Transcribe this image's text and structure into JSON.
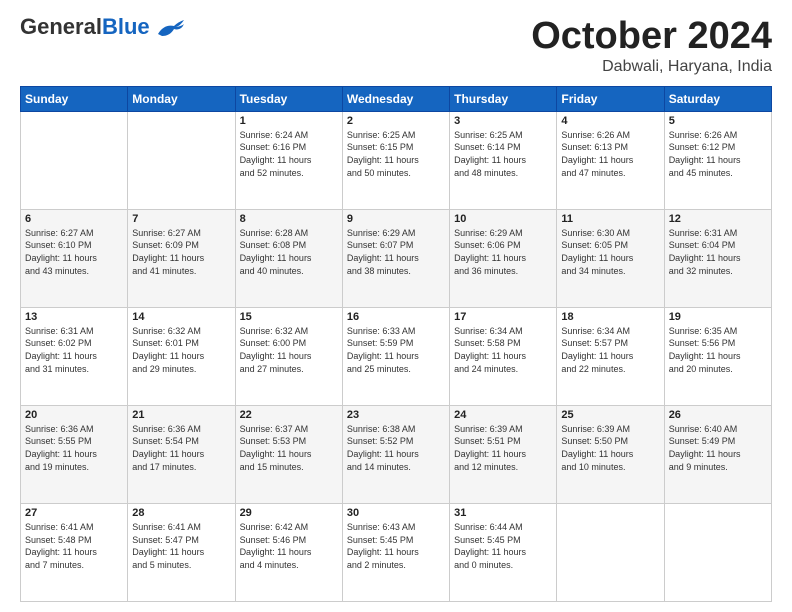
{
  "header": {
    "logo_general": "General",
    "logo_blue": "Blue",
    "month_title": "October 2024",
    "subtitle": "Dabwali, Haryana, India"
  },
  "days_of_week": [
    "Sunday",
    "Monday",
    "Tuesday",
    "Wednesday",
    "Thursday",
    "Friday",
    "Saturday"
  ],
  "weeks": [
    [
      {
        "day": "",
        "info": ""
      },
      {
        "day": "",
        "info": ""
      },
      {
        "day": "1",
        "info": "Sunrise: 6:24 AM\nSunset: 6:16 PM\nDaylight: 11 hours\nand 52 minutes."
      },
      {
        "day": "2",
        "info": "Sunrise: 6:25 AM\nSunset: 6:15 PM\nDaylight: 11 hours\nand 50 minutes."
      },
      {
        "day": "3",
        "info": "Sunrise: 6:25 AM\nSunset: 6:14 PM\nDaylight: 11 hours\nand 48 minutes."
      },
      {
        "day": "4",
        "info": "Sunrise: 6:26 AM\nSunset: 6:13 PM\nDaylight: 11 hours\nand 47 minutes."
      },
      {
        "day": "5",
        "info": "Sunrise: 6:26 AM\nSunset: 6:12 PM\nDaylight: 11 hours\nand 45 minutes."
      }
    ],
    [
      {
        "day": "6",
        "info": "Sunrise: 6:27 AM\nSunset: 6:10 PM\nDaylight: 11 hours\nand 43 minutes."
      },
      {
        "day": "7",
        "info": "Sunrise: 6:27 AM\nSunset: 6:09 PM\nDaylight: 11 hours\nand 41 minutes."
      },
      {
        "day": "8",
        "info": "Sunrise: 6:28 AM\nSunset: 6:08 PM\nDaylight: 11 hours\nand 40 minutes."
      },
      {
        "day": "9",
        "info": "Sunrise: 6:29 AM\nSunset: 6:07 PM\nDaylight: 11 hours\nand 38 minutes."
      },
      {
        "day": "10",
        "info": "Sunrise: 6:29 AM\nSunset: 6:06 PM\nDaylight: 11 hours\nand 36 minutes."
      },
      {
        "day": "11",
        "info": "Sunrise: 6:30 AM\nSunset: 6:05 PM\nDaylight: 11 hours\nand 34 minutes."
      },
      {
        "day": "12",
        "info": "Sunrise: 6:31 AM\nSunset: 6:04 PM\nDaylight: 11 hours\nand 32 minutes."
      }
    ],
    [
      {
        "day": "13",
        "info": "Sunrise: 6:31 AM\nSunset: 6:02 PM\nDaylight: 11 hours\nand 31 minutes."
      },
      {
        "day": "14",
        "info": "Sunrise: 6:32 AM\nSunset: 6:01 PM\nDaylight: 11 hours\nand 29 minutes."
      },
      {
        "day": "15",
        "info": "Sunrise: 6:32 AM\nSunset: 6:00 PM\nDaylight: 11 hours\nand 27 minutes."
      },
      {
        "day": "16",
        "info": "Sunrise: 6:33 AM\nSunset: 5:59 PM\nDaylight: 11 hours\nand 25 minutes."
      },
      {
        "day": "17",
        "info": "Sunrise: 6:34 AM\nSunset: 5:58 PM\nDaylight: 11 hours\nand 24 minutes."
      },
      {
        "day": "18",
        "info": "Sunrise: 6:34 AM\nSunset: 5:57 PM\nDaylight: 11 hours\nand 22 minutes."
      },
      {
        "day": "19",
        "info": "Sunrise: 6:35 AM\nSunset: 5:56 PM\nDaylight: 11 hours\nand 20 minutes."
      }
    ],
    [
      {
        "day": "20",
        "info": "Sunrise: 6:36 AM\nSunset: 5:55 PM\nDaylight: 11 hours\nand 19 minutes."
      },
      {
        "day": "21",
        "info": "Sunrise: 6:36 AM\nSunset: 5:54 PM\nDaylight: 11 hours\nand 17 minutes."
      },
      {
        "day": "22",
        "info": "Sunrise: 6:37 AM\nSunset: 5:53 PM\nDaylight: 11 hours\nand 15 minutes."
      },
      {
        "day": "23",
        "info": "Sunrise: 6:38 AM\nSunset: 5:52 PM\nDaylight: 11 hours\nand 14 minutes."
      },
      {
        "day": "24",
        "info": "Sunrise: 6:39 AM\nSunset: 5:51 PM\nDaylight: 11 hours\nand 12 minutes."
      },
      {
        "day": "25",
        "info": "Sunrise: 6:39 AM\nSunset: 5:50 PM\nDaylight: 11 hours\nand 10 minutes."
      },
      {
        "day": "26",
        "info": "Sunrise: 6:40 AM\nSunset: 5:49 PM\nDaylight: 11 hours\nand 9 minutes."
      }
    ],
    [
      {
        "day": "27",
        "info": "Sunrise: 6:41 AM\nSunset: 5:48 PM\nDaylight: 11 hours\nand 7 minutes."
      },
      {
        "day": "28",
        "info": "Sunrise: 6:41 AM\nSunset: 5:47 PM\nDaylight: 11 hours\nand 5 minutes."
      },
      {
        "day": "29",
        "info": "Sunrise: 6:42 AM\nSunset: 5:46 PM\nDaylight: 11 hours\nand 4 minutes."
      },
      {
        "day": "30",
        "info": "Sunrise: 6:43 AM\nSunset: 5:45 PM\nDaylight: 11 hours\nand 2 minutes."
      },
      {
        "day": "31",
        "info": "Sunrise: 6:44 AM\nSunset: 5:45 PM\nDaylight: 11 hours\nand 0 minutes."
      },
      {
        "day": "",
        "info": ""
      },
      {
        "day": "",
        "info": ""
      }
    ]
  ]
}
